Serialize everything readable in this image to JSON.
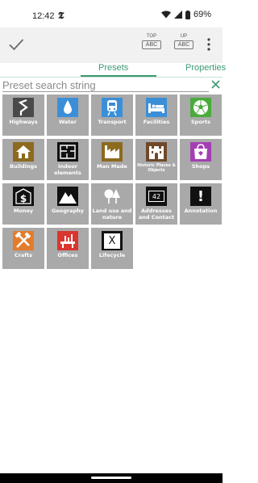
{
  "status_bar": {
    "time": "12:42",
    "app_badge": "𝕿",
    "battery": "69%"
  },
  "toolbar": {
    "top_small": "TOP",
    "top_box": "ABC",
    "up_small": "UP",
    "up_box": "ABC"
  },
  "tabs": [
    {
      "label": "Presets",
      "active": true
    },
    {
      "label": "Properties",
      "active": false
    }
  ],
  "search": {
    "placeholder": "Preset search string",
    "value": ""
  },
  "colors": {
    "accent": "#3c9a74",
    "tile_bg": "#a9a9a9"
  },
  "presets": [
    {
      "label": "Highways",
      "icon": "highway-icon"
    },
    {
      "label": "Water",
      "icon": "water-drop-icon"
    },
    {
      "label": "Transport",
      "icon": "train-icon"
    },
    {
      "label": "Facilities",
      "icon": "bed-icon"
    },
    {
      "label": "Sports",
      "icon": "soccer-ball-icon"
    },
    {
      "label": "Buildings",
      "icon": "house-icon"
    },
    {
      "label": "Indoor elements",
      "icon": "floorplan-icon"
    },
    {
      "label": "Man Made",
      "icon": "factory-icon"
    },
    {
      "label": "Historic Places & Objects",
      "icon": "castle-icon"
    },
    {
      "label": "Shops",
      "icon": "shopping-bag-icon"
    },
    {
      "label": "Money",
      "icon": "dollar-icon"
    },
    {
      "label": "Geography",
      "icon": "mountain-icon"
    },
    {
      "label": "Land use and nature",
      "icon": "trees-icon"
    },
    {
      "label": "Addresses and Contact",
      "icon": "address-number-icon",
      "icon_text": "42"
    },
    {
      "label": "Annotation",
      "icon": "exclamation-icon",
      "icon_text": "!"
    },
    {
      "label": "Crafts",
      "icon": "hammer-icon"
    },
    {
      "label": "Offices",
      "icon": "office-chart-icon"
    },
    {
      "label": "Lifecycle",
      "icon": "lifecycle-x-icon",
      "icon_text": "X"
    }
  ]
}
